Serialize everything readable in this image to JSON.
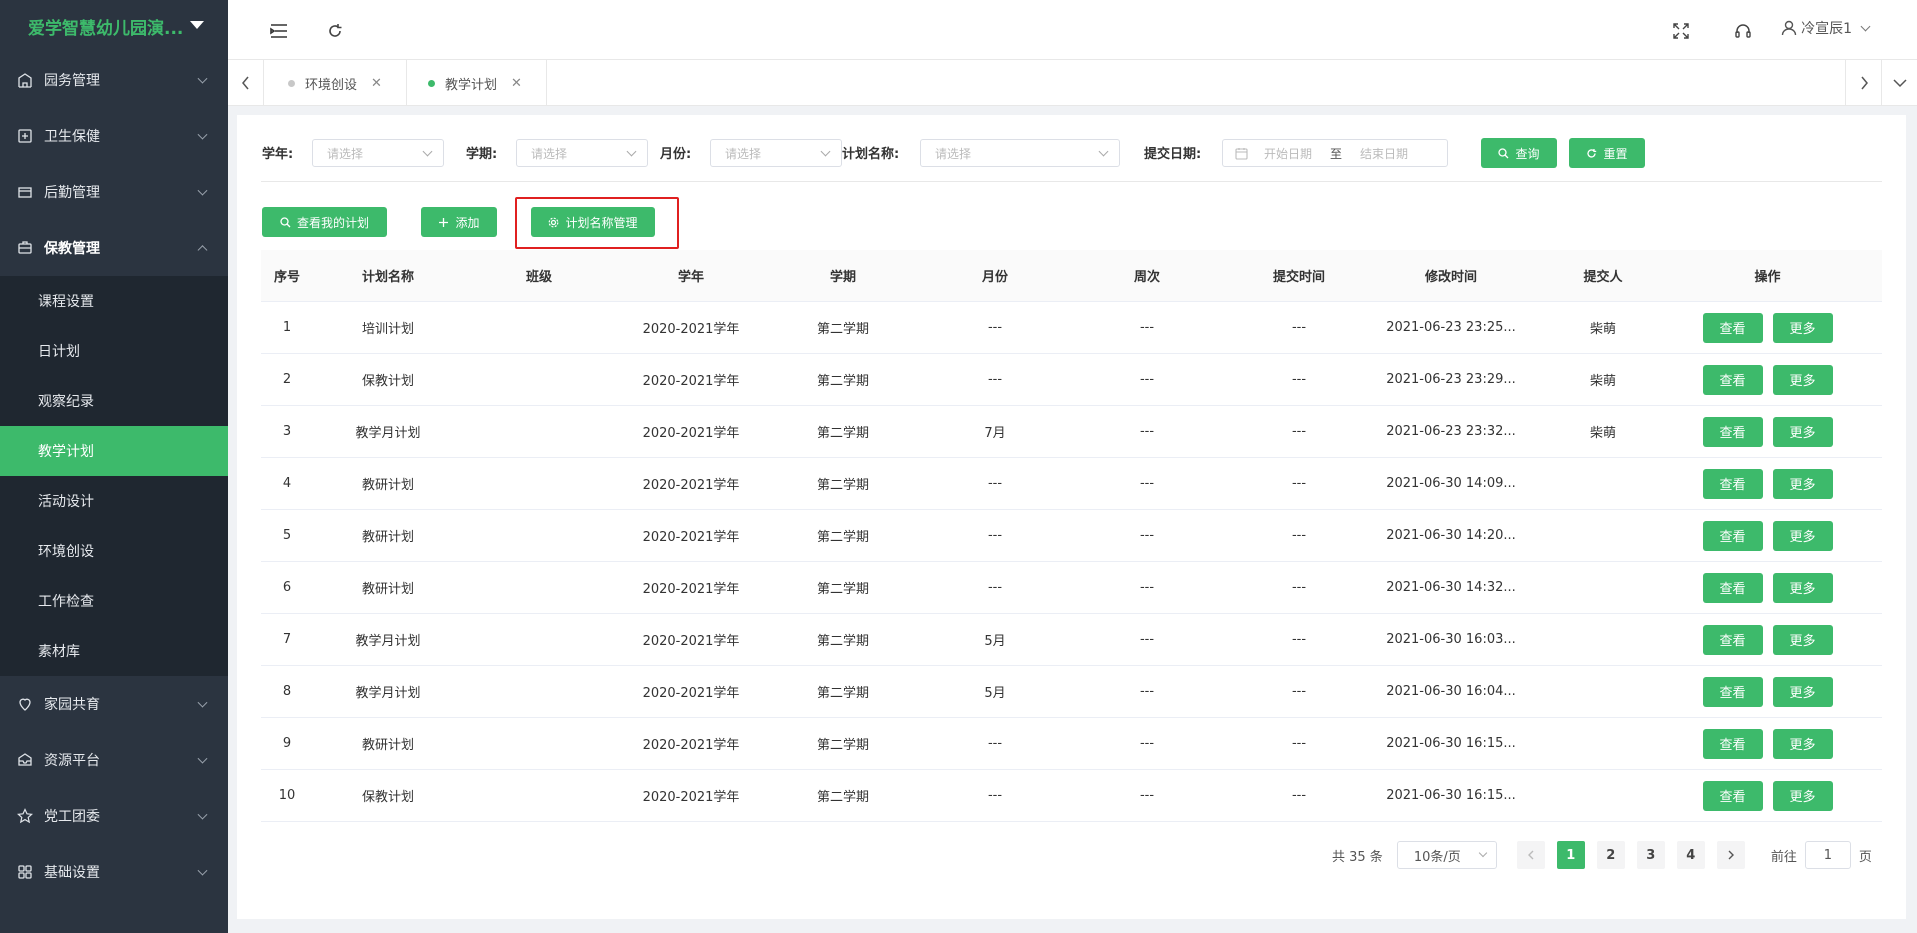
{
  "sidebar": {
    "brand": "爱学智慧幼儿园演...",
    "menu": [
      {
        "label": "园务管理",
        "icon": "building-icon"
      },
      {
        "label": "卫生保健",
        "icon": "health-icon"
      },
      {
        "label": "后勤管理",
        "icon": "logistics-icon"
      },
      {
        "label": "保教管理",
        "icon": "education-icon"
      }
    ],
    "submenu": [
      "课程设置",
      "日计划",
      "观察纪录",
      "教学计划",
      "活动设计",
      "环境创设",
      "工作检查",
      "素材库"
    ],
    "active_sub": "教学计划",
    "menu_after": [
      {
        "label": "家园共育",
        "icon": "heart-location-icon"
      },
      {
        "label": "资源平台",
        "icon": "resource-icon"
      },
      {
        "label": "党工团委",
        "icon": "star-icon"
      },
      {
        "label": "基础设置",
        "icon": "grid-icon"
      }
    ]
  },
  "header": {
    "user_name": "冷宣辰1"
  },
  "tabs": [
    {
      "label": "环境创设",
      "active": false
    },
    {
      "label": "教学计划",
      "active": true
    }
  ],
  "filter": {
    "school_year_label": "学年:",
    "school_year_placeholder": "请选择",
    "semester_label": "学期:",
    "semester_placeholder": "请选择",
    "month_label": "月份:",
    "month_placeholder": "请选择",
    "plan_name_label": "计划名称:",
    "plan_name_placeholder": "请选择",
    "submit_date_label": "提交日期:",
    "start_placeholder": "开始日期",
    "range_sep": "至",
    "end_placeholder": "结束日期",
    "query_label": "查询",
    "reset_label": "重置"
  },
  "actions": {
    "my_plans": "查看我的计划",
    "add": "添加",
    "plan_name_manage": "计划名称管理"
  },
  "table": {
    "headers": [
      "序号",
      "计划名称",
      "班级",
      "学年",
      "学期",
      "月份",
      "周次",
      "提交时间",
      "修改时间",
      "提交人",
      "操作"
    ],
    "view_label": "查看",
    "more_label": "更多",
    "rows": [
      {
        "no": "1",
        "name": "培训计划",
        "class": "",
        "year": "2020-2021学年",
        "semester": "第二学期",
        "month": "---",
        "week": "---",
        "submit": "---",
        "modified": "2021-06-23 23:25...",
        "submitter": "柴萌"
      },
      {
        "no": "2",
        "name": "保教计划",
        "class": "",
        "year": "2020-2021学年",
        "semester": "第二学期",
        "month": "---",
        "week": "---",
        "submit": "---",
        "modified": "2021-06-23 23:29...",
        "submitter": "柴萌"
      },
      {
        "no": "3",
        "name": "教学月计划",
        "class": "",
        "year": "2020-2021学年",
        "semester": "第二学期",
        "month": "7月",
        "week": "---",
        "submit": "---",
        "modified": "2021-06-23 23:32...",
        "submitter": "柴萌"
      },
      {
        "no": "4",
        "name": "教研计划",
        "class": "",
        "year": "2020-2021学年",
        "semester": "第二学期",
        "month": "---",
        "week": "---",
        "submit": "---",
        "modified": "2021-06-30 14:09...",
        "submitter": ""
      },
      {
        "no": "5",
        "name": "教研计划",
        "class": "",
        "year": "2020-2021学年",
        "semester": "第二学期",
        "month": "---",
        "week": "---",
        "submit": "---",
        "modified": "2021-06-30 14:20...",
        "submitter": ""
      },
      {
        "no": "6",
        "name": "教研计划",
        "class": "",
        "year": "2020-2021学年",
        "semester": "第二学期",
        "month": "---",
        "week": "---",
        "submit": "---",
        "modified": "2021-06-30 14:32...",
        "submitter": ""
      },
      {
        "no": "7",
        "name": "教学月计划",
        "class": "",
        "year": "2020-2021学年",
        "semester": "第二学期",
        "month": "5月",
        "week": "---",
        "submit": "---",
        "modified": "2021-06-30 16:03...",
        "submitter": ""
      },
      {
        "no": "8",
        "name": "教学月计划",
        "class": "",
        "year": "2020-2021学年",
        "semester": "第二学期",
        "month": "5月",
        "week": "---",
        "submit": "---",
        "modified": "2021-06-30 16:04...",
        "submitter": ""
      },
      {
        "no": "9",
        "name": "教研计划",
        "class": "",
        "year": "2020-2021学年",
        "semester": "第二学期",
        "month": "---",
        "week": "---",
        "submit": "---",
        "modified": "2021-06-30 16:15...",
        "submitter": ""
      },
      {
        "no": "10",
        "name": "保教计划",
        "class": "",
        "year": "2020-2021学年",
        "semester": "第二学期",
        "month": "---",
        "week": "---",
        "submit": "---",
        "modified": "2021-06-30 16:15...",
        "submitter": ""
      }
    ]
  },
  "pagination": {
    "total": "共 35 条",
    "page_size": "10条/页",
    "pages": [
      "1",
      "2",
      "3",
      "4"
    ],
    "current": "1",
    "goto_label": "前往",
    "goto_value": "1",
    "page_suffix": "页"
  },
  "colors": {
    "accent": "#3dba6b",
    "sidebar_bg": "#2b3440",
    "highlight_border": "#e02020"
  }
}
